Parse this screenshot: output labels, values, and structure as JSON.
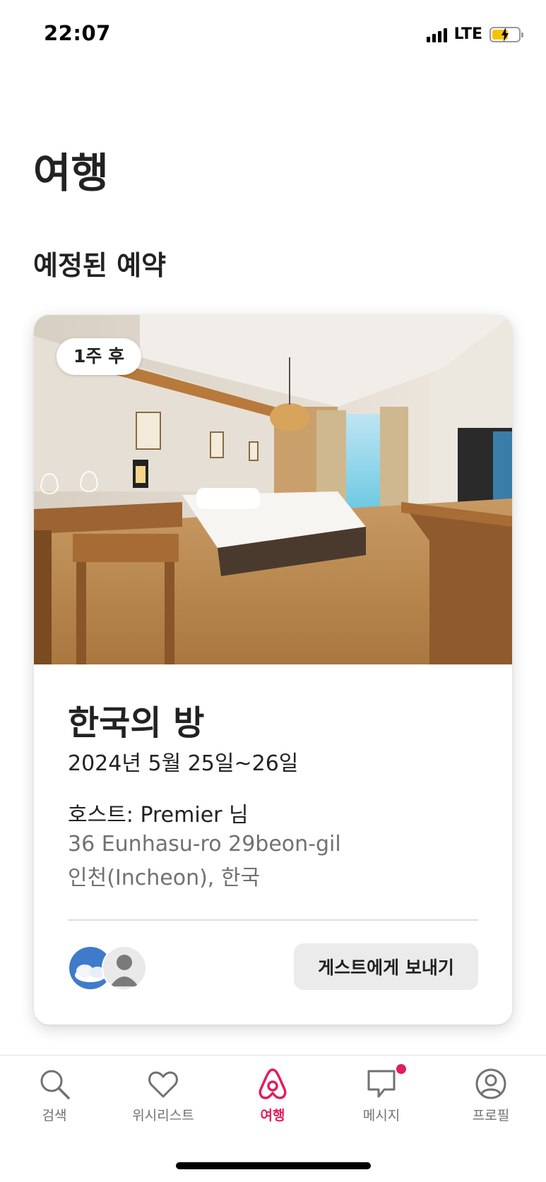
{
  "status_bar": {
    "time": "22:07",
    "network": "LTE",
    "battery_color": "#f5c400"
  },
  "page": {
    "title": "여행",
    "section_title": "예정된 예약"
  },
  "trip": {
    "badge": "1주 후",
    "name": "한국의 방",
    "dates": "2024년 5월 25일~26일",
    "host": "호스트: Premier 님",
    "address_line1": "36 Eunhasu-ro 29beon-gil",
    "address_line2": "인천(Incheon), 한국",
    "send_button_label": "게스트에게 보내기"
  },
  "tabs": [
    {
      "label": "검색",
      "icon": "search-icon",
      "active": false
    },
    {
      "label": "위시리스트",
      "icon": "heart-icon",
      "active": false
    },
    {
      "label": "여행",
      "icon": "airbnb-logo-icon",
      "active": true
    },
    {
      "label": "메시지",
      "icon": "message-icon",
      "active": false,
      "notification": true
    },
    {
      "label": "프로필",
      "icon": "profile-icon",
      "active": false
    }
  ],
  "colors": {
    "accent": "#e31c5f",
    "text_primary": "#222222",
    "text_secondary": "#717171"
  }
}
